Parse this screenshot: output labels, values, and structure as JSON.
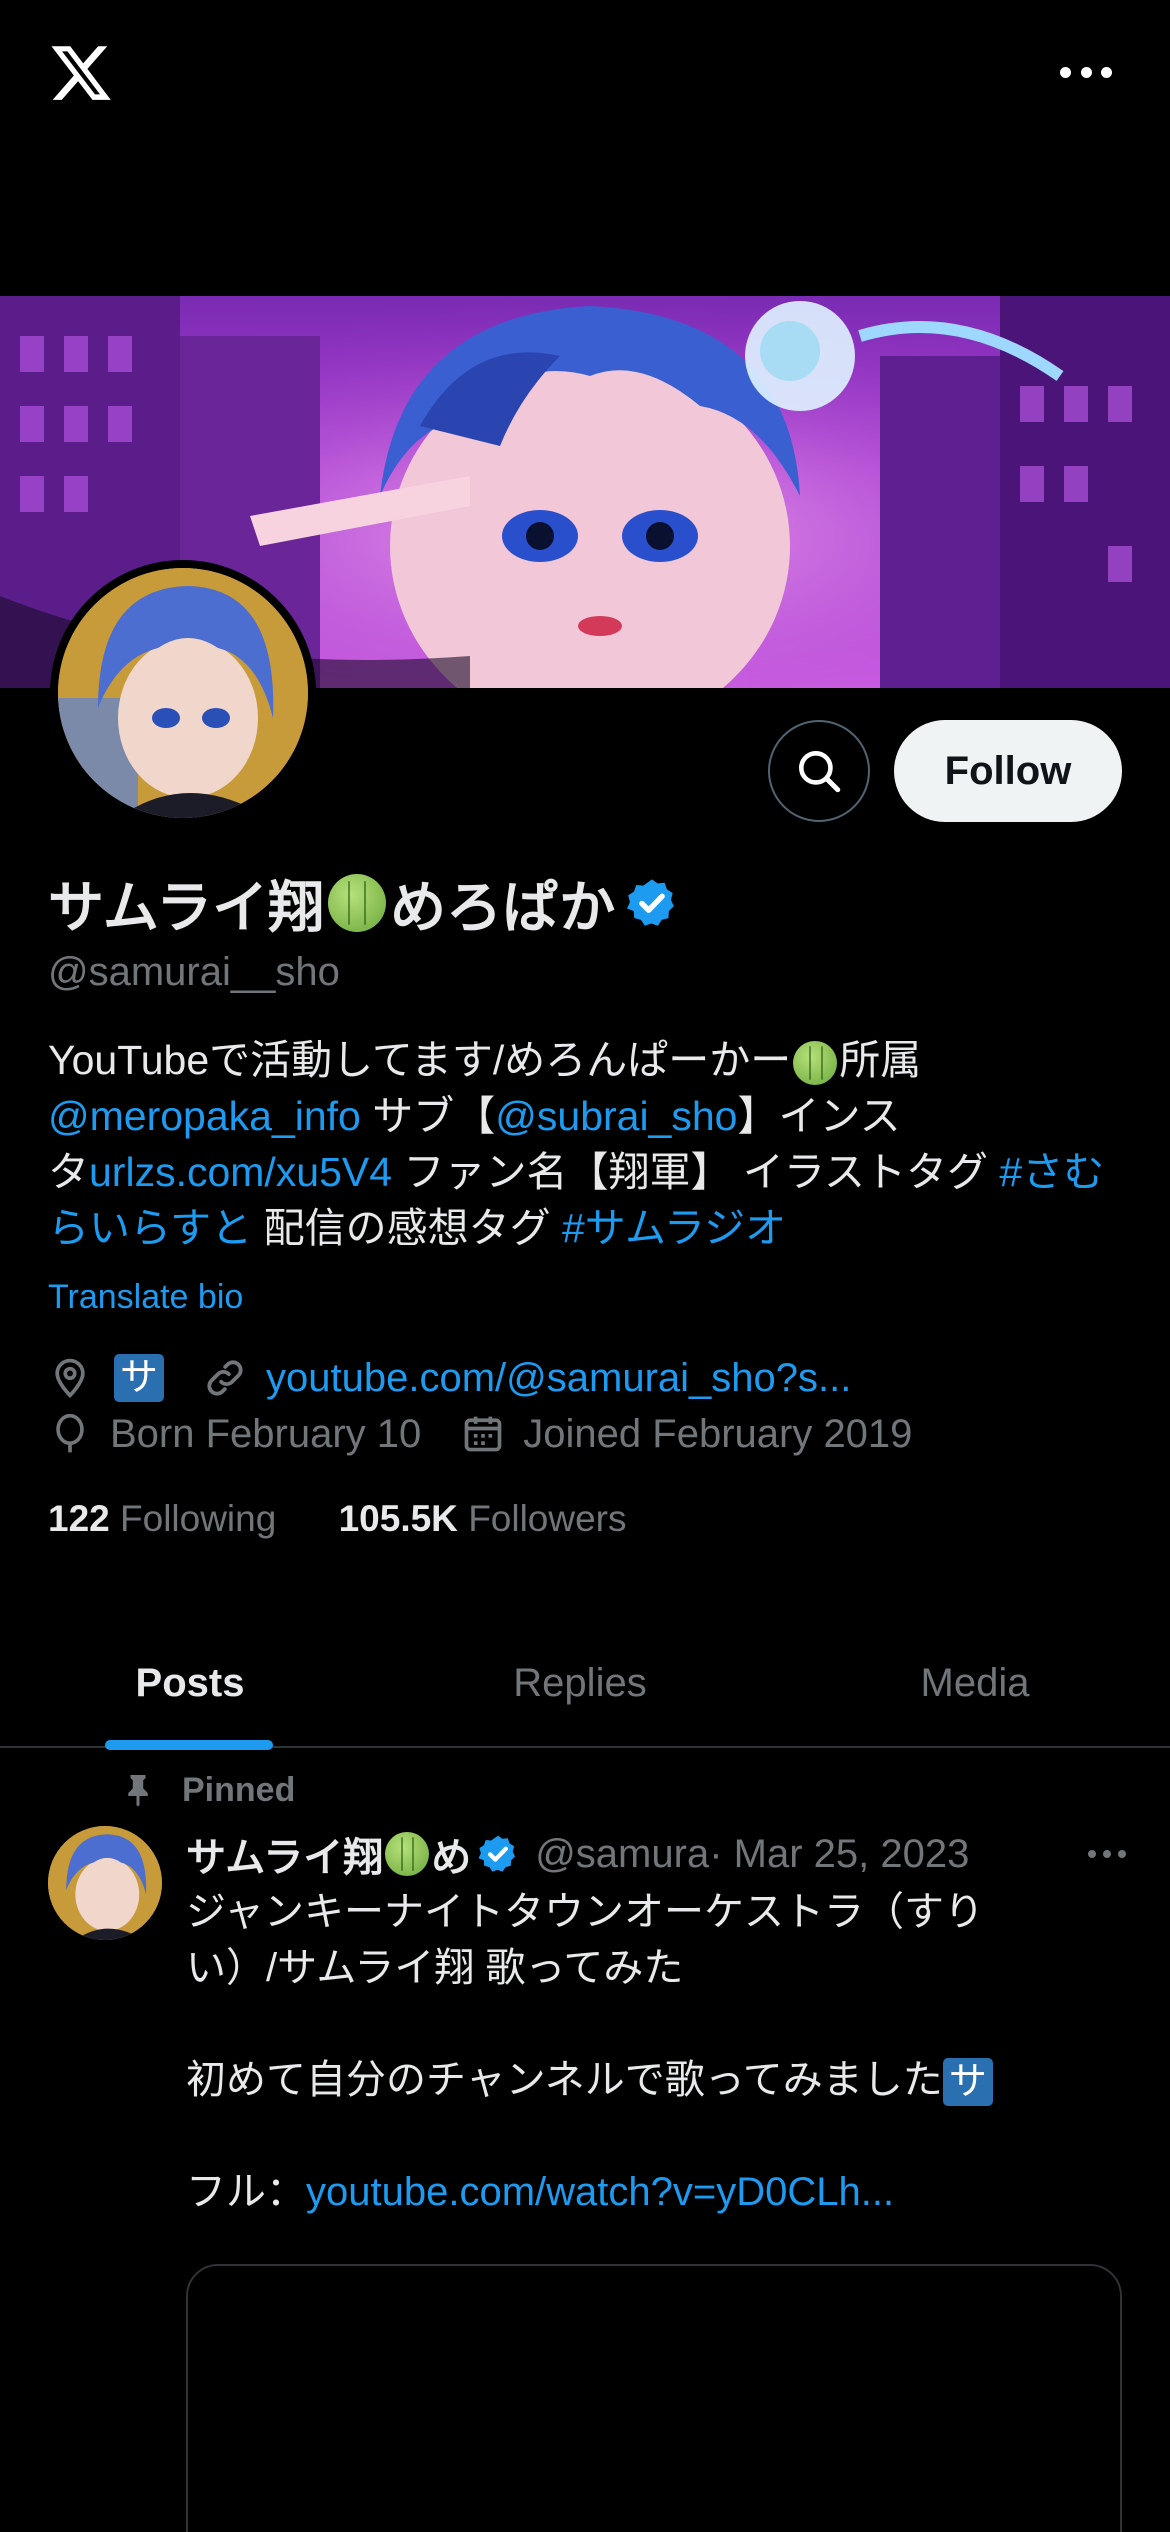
{
  "profile": {
    "display_name": "サムライ翔",
    "display_name_suffix": "めろぱか",
    "handle": "@samurai__sho",
    "follow_label": "Follow",
    "bio": {
      "line1_a": "YouTubeで活動してます/めろんぱーかー",
      "line1_b": "所属",
      "mention1": "@meropaka_info",
      "mid1": " サブ【",
      "mention2": "@subrai_sho",
      "mid2": "】インス",
      "mid3": "タ",
      "link1": "urlzs.com/xu5V4",
      "mid4": " ファン名【翔軍】 イラストタグ ",
      "hashtag1": "#さむらいらすと",
      "mid5": " 配信の感想タグ ",
      "hashtag2": "#サムラジオ"
    },
    "translate_label": "Translate bio",
    "location_text": "サ",
    "website": "youtube.com/@samurai_sho?s...",
    "born": "Born February 10",
    "joined": "Joined February 2019",
    "following_count": "122",
    "following_label": "Following",
    "followers_count": "105.5K",
    "followers_label": "Followers"
  },
  "tabs": [
    {
      "label": "Posts"
    },
    {
      "label": "Replies"
    },
    {
      "label": "Media"
    }
  ],
  "post": {
    "pinned_label": "Pinned",
    "author_name": "サムライ翔",
    "author_name_cut": "め",
    "author_handle": "@samura",
    "date": " · Mar 25, 2023",
    "line1": "ジャンキーナイトタウンオーケストラ（すり",
    "line2": "い）/サムライ翔 歌ってみた",
    "line3": "初めて自分のチャンネルで歌ってみました",
    "line3_badge": "サ",
    "line4_prefix": "フル：",
    "line4_link": "youtube.com/watch?v=yD0CLh..."
  },
  "colors": {
    "accent": "#1d9bf0",
    "background": "#000000",
    "text_secondary": "#71767b"
  }
}
